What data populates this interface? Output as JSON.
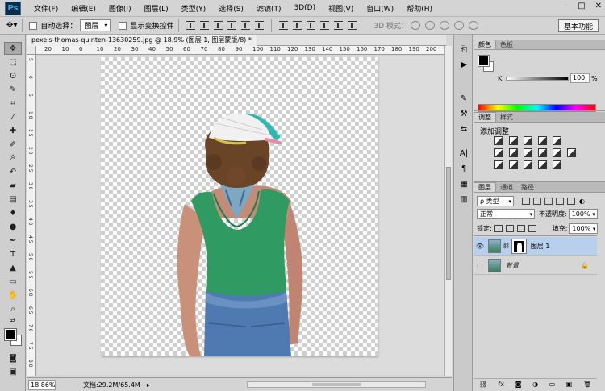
{
  "menubar": {
    "logo": "Ps",
    "items": [
      "文件(F)",
      "编辑(E)",
      "图像(I)",
      "图层(L)",
      "类型(Y)",
      "选择(S)",
      "滤镜(T)",
      "3D(D)",
      "视图(V)",
      "窗口(W)",
      "帮助(H)"
    ],
    "window_controls": [
      "–",
      "□",
      "✕"
    ]
  },
  "options": {
    "auto_select_label": "自动选择：",
    "auto_select_target": "图层",
    "show_transform_label": "显示变换控件",
    "mode3d_label": "3D 模式：",
    "workspace": "基本功能"
  },
  "document": {
    "tab_title": "pexels-thomas-quinten-13630259.jpg @ 18.9% (图层 1, 图层蒙版/8) *",
    "ruler_top": [
      "20",
      "10",
      "0",
      "10",
      "20",
      "30",
      "40",
      "50",
      "60",
      "70",
      "80",
      "90",
      "100",
      "110",
      "120",
      "130",
      "140",
      "150",
      "160",
      "170",
      "180",
      "190",
      "200"
    ],
    "ruler_left": [
      "5",
      "0",
      "5",
      "1 0",
      "1 5",
      "2 0",
      "2 5",
      "3 0",
      "3 5",
      "4 0",
      "4 5",
      "5 0",
      "5 5",
      "6 0",
      "6 5",
      "7 0",
      "7 5",
      "8 0"
    ],
    "zoom": "18.86%",
    "doc_info": "文档:29.2M/65.4M"
  },
  "colors": {
    "accent_selected_layer": "#b8cfed",
    "shirt": "#2f9b62",
    "jeans": "#4e79b1"
  },
  "color_panel": {
    "tabs": [
      "颜色",
      "色板"
    ],
    "channel_label": "K",
    "value": "100",
    "unit": "%"
  },
  "adjust_panel": {
    "tabs": [
      "调整",
      "样式"
    ],
    "title": "添加调整"
  },
  "layers_panel": {
    "tabs": [
      "图层",
      "通道",
      "路径"
    ],
    "filter_kind": "ρ 类型",
    "blend_mode": "正常",
    "opacity_label": "不透明度:",
    "opacity_value": "100%",
    "lock_label": "锁定:",
    "fill_label": "填充:",
    "fill_value": "100%",
    "layers": [
      {
        "name": "图层 1",
        "selected": true
      },
      {
        "name": "背景",
        "selected": false
      }
    ],
    "bottom_icons": [
      "link-icon",
      "fx-icon",
      "mask-icon",
      "adjustment-icon",
      "folder-icon",
      "new-layer-icon",
      "trash-icon"
    ]
  }
}
